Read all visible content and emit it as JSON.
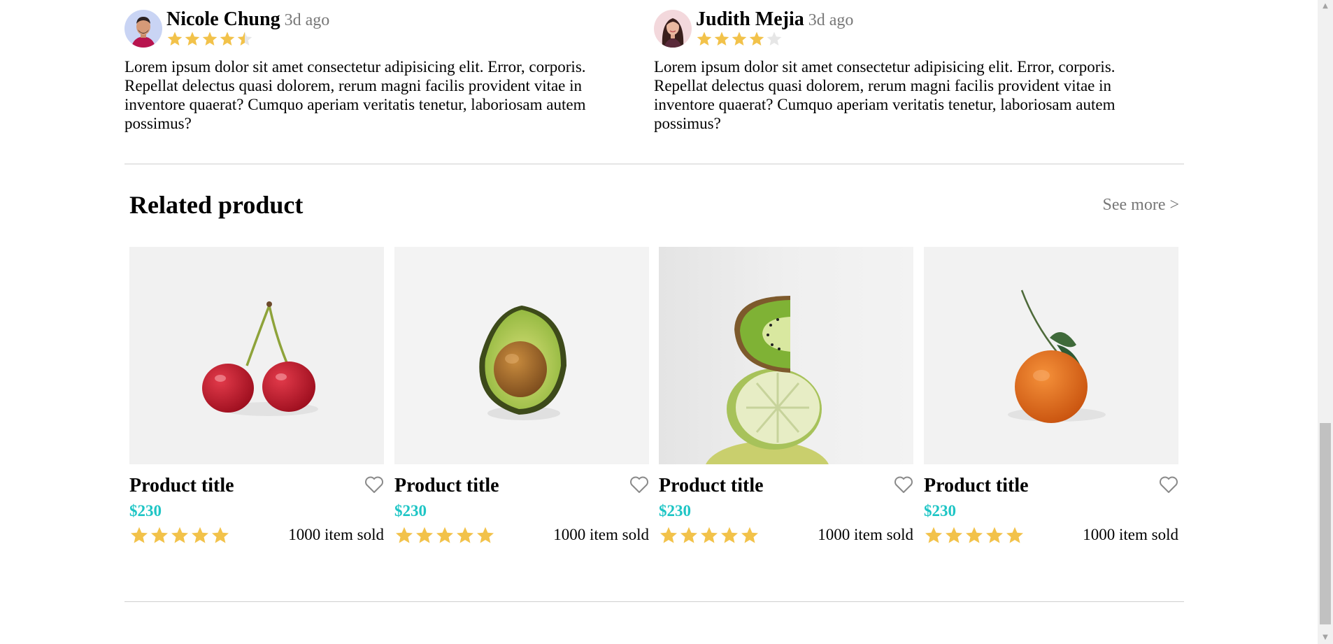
{
  "reviews": [
    {
      "name": "Nicole Chung",
      "time": "3d ago",
      "rating": 4.5,
      "text": "Lorem ipsum dolor sit amet consectetur adipisicing elit. Error, corporis. Repellat delectus quasi dolorem, rerum magni facilis provident vitae in inventore quaerat? Cumquo aperiam veritatis tenetur, laboriosam autem possimus?"
    },
    {
      "name": "Judith Mejia",
      "time": "3d ago",
      "rating": 4,
      "text": "Lorem ipsum dolor sit amet consectetur adipisicing elit. Error, corporis. Repellat delectus quasi dolorem, rerum magni facilis provident vitae in inventore quaerat? Cumquo aperiam veritatis tenetur, laboriosam autem possimus?"
    }
  ],
  "related": {
    "title": "Related product",
    "see_more": "See more >"
  },
  "products": [
    {
      "title": "Product title",
      "price": "$230",
      "rating": 5,
      "sold": "1000 item sold",
      "image": "cherries"
    },
    {
      "title": "Product title",
      "price": "$230",
      "rating": 5,
      "sold": "1000 item sold",
      "image": "avocado"
    },
    {
      "title": "Product title",
      "price": "$230",
      "rating": 5,
      "sold": "1000 item sold",
      "image": "kiwi-lime"
    },
    {
      "title": "Product title",
      "price": "$230",
      "rating": 5,
      "sold": "1000 item sold",
      "image": "tangerine"
    }
  ],
  "colors": {
    "accent": "#1ec5c5",
    "star": "#f2c24a",
    "star_empty": "#e6e6e6",
    "muted": "#777777",
    "divider": "#cfcfcf"
  }
}
